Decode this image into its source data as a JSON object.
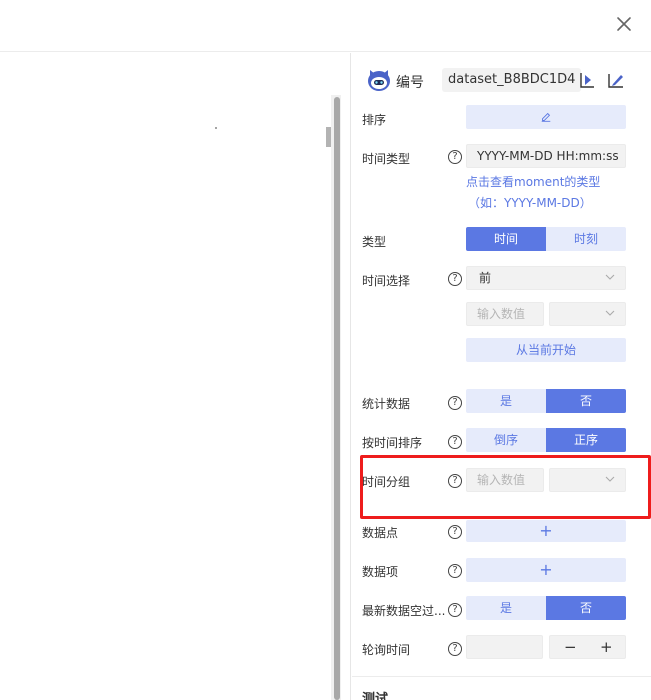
{
  "header": {
    "close_icon": "close-icon"
  },
  "panel": {
    "id_label": "编号",
    "id_value": "dataset_B8BDC1D4",
    "icons": [
      "robot-avatar-icon",
      "import-icon",
      "export-icon"
    ]
  },
  "fields": {
    "sort": {
      "label": "排序",
      "button_icon": "edit-icon"
    },
    "time_type": {
      "label": "时间类型",
      "value": "YYYY-MM-DD HH:mm:ss",
      "hint_line1": "点击查看moment的类型",
      "hint_line2": "（如：YYYY-MM-DD）"
    },
    "type": {
      "label": "类型",
      "option_a": "时间",
      "option_b": "时刻",
      "selected": "时间"
    },
    "time_select": {
      "label": "时间选择",
      "direction": "前",
      "number_placeholder": "输入数值",
      "unit_value": "",
      "from_now": "从当前开始"
    },
    "stat_data": {
      "label": "统计数据",
      "yes": "是",
      "no": "否",
      "selected": "否"
    },
    "sort_by_time": {
      "label": "按时间排序",
      "desc": "倒序",
      "asc": "正序",
      "selected": "正序"
    },
    "time_group": {
      "label": "时间分组",
      "number_placeholder": "输入数值",
      "unit_value": ""
    },
    "data_points": {
      "label": "数据点",
      "add": "+"
    },
    "data_items": {
      "label": "数据项",
      "add": "+"
    },
    "latest_empty": {
      "label": "最新数据空过...",
      "yes": "是",
      "no": "否",
      "selected": "否"
    },
    "poll_time": {
      "label": "轮询时间",
      "value": "",
      "minus": "−",
      "plus": "+"
    }
  },
  "test_section": {
    "title": "测试"
  },
  "colors": {
    "accent": "#5b78e3",
    "accent_light": "#e6ebfb",
    "highlight": "#ee1c1c"
  }
}
